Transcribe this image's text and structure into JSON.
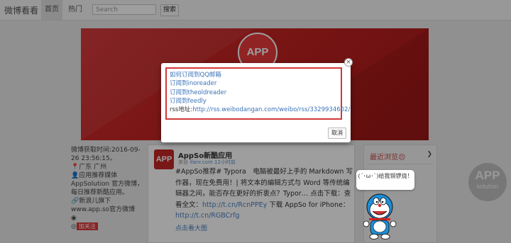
{
  "navbar": {
    "brand": "微博看看",
    "home": "首页",
    "hot": "热门",
    "search_placeholder": "Search",
    "search_button": "搜索"
  },
  "banner": {
    "logo_text": "APP"
  },
  "profile": {
    "fetch_time_label": "微博获取时间:2016-09-26 23:56:15。",
    "location": "广东 广州",
    "intro": "应用推荐媒体 AppSolution 官方微博，每日推荐新酷应用。",
    "website": "新浪儿旗下www.app.so官方微博",
    "tag1": "",
    "tag2": "加关注"
  },
  "post": {
    "avatar_text": "APP",
    "author": "AppSo新酷应用",
    "meta_via": "来自",
    "meta_source": "ifanr.com",
    "meta_time": "12小时前",
    "text_pre": "#AppSo推荐# Typora　电脑被最好上手的 Markdown 写作器，现在免费用！| 将文本的编辑方式与 Word 等传统编辑器之间，能否存在更好的折衷点？Typor… 点击下载：查看全文：",
    "link1": "http://t.cn/RcnPPEy",
    "text_mid": " 下载 AppSo for iPhone：",
    "link2": "http://t.cn/RGBCrfg",
    "see_large": "点击看大图"
  },
  "widget": {
    "title": "最近浏览😣",
    "caret": "❯"
  },
  "watermark": {
    "big": "APP",
    "small": "solution"
  },
  "modal": {
    "links": [
      "如何订阅到QQ邮箱",
      "订阅到inoreader",
      "订阅到theoldreader",
      "订阅到feedly"
    ],
    "rss_label": "rss地址:",
    "rss_url": "http://rss.weibodangan.com/weibo/rss/3329934602/",
    "cancel": "取消",
    "close": "×"
  },
  "mascot": {
    "bubble": "(´･ω･`)给我铜锣烧！"
  }
}
